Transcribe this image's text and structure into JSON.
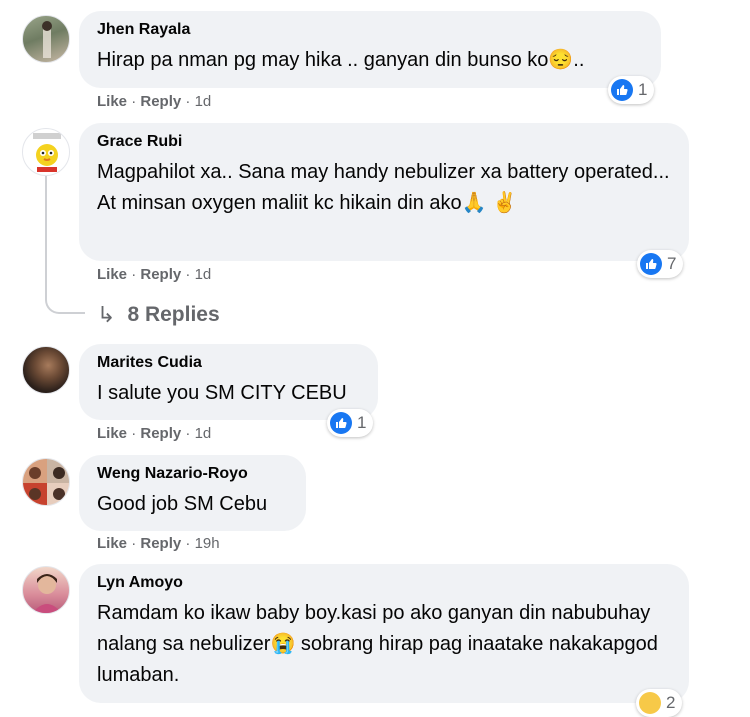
{
  "comments": [
    {
      "name": "Jhen Rayala",
      "text": "Hirap pa nman pg may hika .. ganyan din bunso ko😔..",
      "like": "Like",
      "reply": "Reply",
      "time": "1d",
      "reaction_count": "1"
    },
    {
      "name": "Grace Rubi",
      "text": "Magpahilot xa.. Sana may handy nebulizer xa battery operated... At minsan oxygen maliit kc hikain din ako🙏 ✌️",
      "like": "Like",
      "reply": "Reply",
      "time": "1d",
      "reaction_count": "7",
      "replies_label": "8 Replies"
    },
    {
      "name": "Marites Cudia",
      "text": "I salute you SM CITY CEBU",
      "like": "Like",
      "reply": "Reply",
      "time": "1d",
      "reaction_count": "1"
    },
    {
      "name": "Weng Nazario-Royo",
      "text": "Good job SM Cebu",
      "like": "Like",
      "reply": "Reply",
      "time": "19h"
    },
    {
      "name": "Lyn Amoyo",
      "text": "Ramdam ko ikaw baby boy.kasi po ako ganyan din nabubuhay nalang sa nebulizer😭 sobrang hirap pag inaatake nakakapgod lumaban.",
      "reaction_count": "2"
    }
  ],
  "colors": {
    "bubble": "#f0f2f5",
    "like_blue": "#1877f2",
    "meta_gray": "#65676b"
  }
}
